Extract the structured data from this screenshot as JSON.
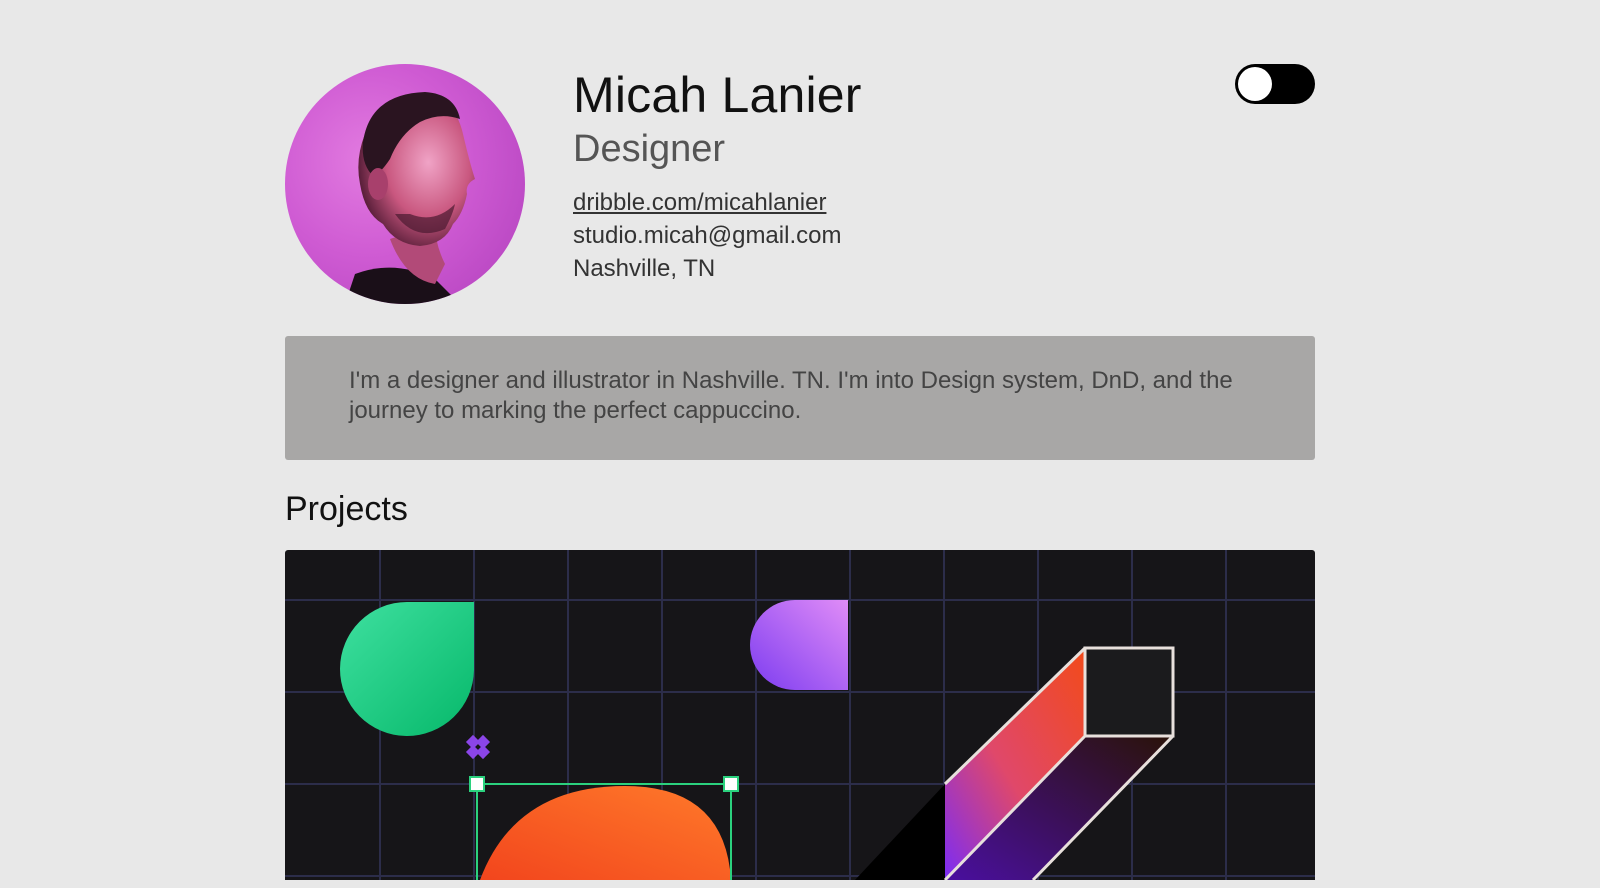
{
  "profile": {
    "name": "Micah Lanier",
    "role": "Designer",
    "website": "dribble.com/micahlanier",
    "email": "studio.micah@gmail.com",
    "location": "Nashville, TN",
    "avatar_icon": "portrait-photo"
  },
  "theme_toggle": {
    "state": "off",
    "track_color": "#000000",
    "knob_color": "#ffffff"
  },
  "bio": {
    "text": "I'm a designer and illustrator in Nashville. TN. I'm into Design system, DnD, and the journey to marking the perfect cappuccino."
  },
  "projects": {
    "heading": "Projects",
    "items": [
      {
        "image_icon": "geometric-shapes-artwork"
      }
    ]
  },
  "colors": {
    "background": "#e8e8e8",
    "bio_background": "#a8a7a6",
    "avatar_background": "#cf5bd3",
    "project_background": "#161518"
  }
}
